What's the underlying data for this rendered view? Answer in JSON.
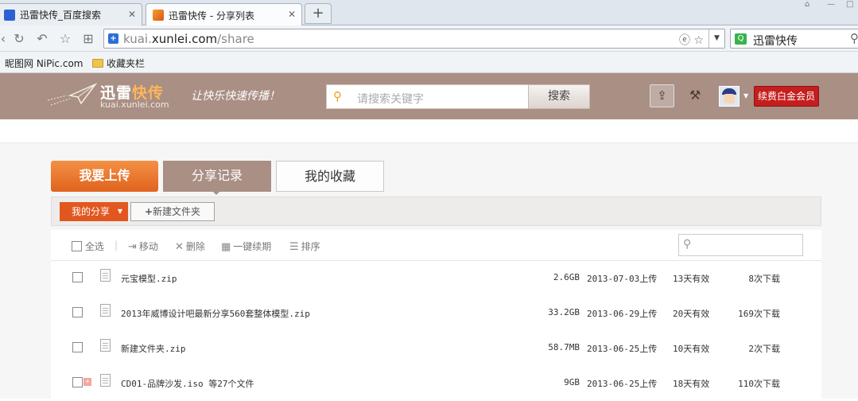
{
  "browser": {
    "tabs": [
      {
        "title": "迅雷快传_百度搜索",
        "active": false,
        "icon": "baidu-paw-icon"
      },
      {
        "title": "迅雷快传 - 分享列表",
        "active": true,
        "icon": "xunlei-plane-icon"
      }
    ],
    "new_tab_label": "+",
    "address": {
      "prefix": "kuai.",
      "domain": "xunlei.com",
      "path": "/share"
    },
    "search_engine_text": "迅雷快传",
    "bookmarks": [
      {
        "label": "昵图网 NiPic.com",
        "icon": "none"
      },
      {
        "label": "收藏夹栏",
        "icon": "folder-icon"
      }
    ]
  },
  "site": {
    "logo_main": "迅雷",
    "logo_highlight": "快传",
    "logo_url": "kuai.xunlei.com",
    "slogan": "让快乐快速传播！",
    "search_placeholder": "请搜索关键字",
    "search_button": "搜索",
    "vip_button": "续费白金会员",
    "colors": {
      "header": "#a98f84",
      "accent_orange": "#e2571f",
      "vip_red": "#c41e1e"
    }
  },
  "main_tabs": [
    {
      "label": "我要上传"
    },
    {
      "label": "分享记录"
    },
    {
      "label": "我的收藏"
    }
  ],
  "subbar": {
    "my_share": "我的分享",
    "new_folder": "新建文件夹"
  },
  "actions": {
    "select_all": "全选",
    "move": "移动",
    "delete": "删除",
    "renew": "一键续期",
    "sort": "排序"
  },
  "files": [
    {
      "name": "元宝模型.zip",
      "size": "2.6GB",
      "uploaded": "2013-07-03上传",
      "validity": "13天有效",
      "downloads": "8次下载",
      "folder": false
    },
    {
      "name": "2013年威博设计吧最新分享560套整体模型.zip",
      "size": "33.2GB",
      "uploaded": "2013-06-29上传",
      "validity": "20天有效",
      "downloads": "169次下载",
      "folder": false
    },
    {
      "name": "新建文件夹.zip",
      "size": "58.7MB",
      "uploaded": "2013-06-25上传",
      "validity": "10天有效",
      "downloads": "2次下载",
      "folder": false
    },
    {
      "name": "CD01-品牌沙发.iso 等27个文件",
      "size": "9GB",
      "uploaded": "2013-06-25上传",
      "validity": "18天有效",
      "downloads": "110次下载",
      "folder": true
    }
  ]
}
